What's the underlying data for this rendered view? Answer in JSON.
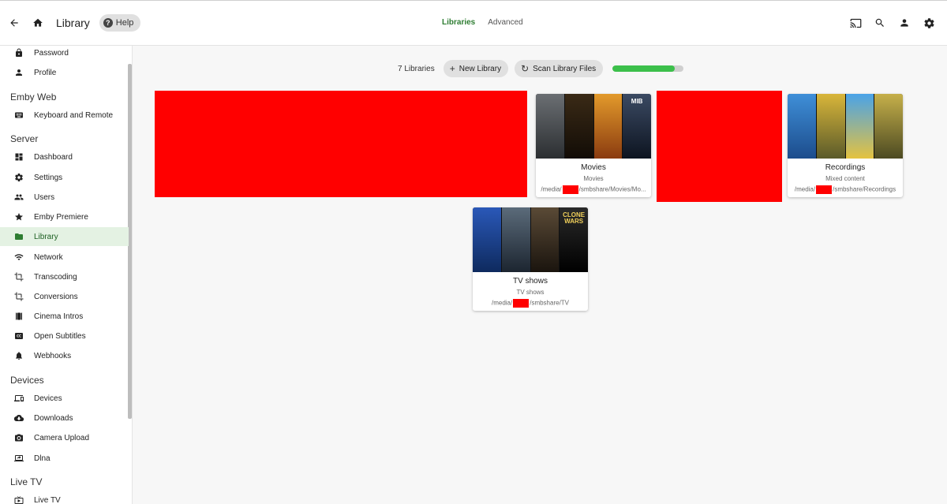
{
  "header": {
    "title": "Library",
    "help_label": "Help",
    "tabs": [
      {
        "label": "Libraries",
        "active": true
      },
      {
        "label": "Advanced",
        "active": false
      }
    ],
    "icons": [
      "back-arrow-icon",
      "home-icon",
      "cast-icon",
      "search-icon",
      "user-icon",
      "gear-icon"
    ],
    "accent_color": "#2e7d32"
  },
  "sidebar": {
    "items_top": [
      {
        "label": "Password",
        "icon": "lock-icon"
      },
      {
        "label": "Profile",
        "icon": "person-icon"
      }
    ],
    "sections": [
      {
        "title": "Emby Web",
        "items": [
          {
            "label": "Keyboard and Remote",
            "icon": "keyboard-icon"
          }
        ]
      },
      {
        "title": "Server",
        "items": [
          {
            "label": "Dashboard",
            "icon": "dashboard-icon"
          },
          {
            "label": "Settings",
            "icon": "gear-icon"
          },
          {
            "label": "Users",
            "icon": "people-icon"
          },
          {
            "label": "Emby Premiere",
            "icon": "star-icon"
          },
          {
            "label": "Library",
            "icon": "folder-icon",
            "active": true
          },
          {
            "label": "Network",
            "icon": "wifi-icon"
          },
          {
            "label": "Transcoding",
            "icon": "crop-icon"
          },
          {
            "label": "Conversions",
            "icon": "crop-icon"
          },
          {
            "label": "Cinema Intros",
            "icon": "film-icon"
          },
          {
            "label": "Open Subtitles",
            "icon": "cc-icon"
          },
          {
            "label": "Webhooks",
            "icon": "bell-icon"
          }
        ]
      },
      {
        "title": "Devices",
        "items": [
          {
            "label": "Devices",
            "icon": "devices-icon"
          },
          {
            "label": "Downloads",
            "icon": "cloud-download-icon"
          },
          {
            "label": "Camera Upload",
            "icon": "camera-icon"
          },
          {
            "label": "Dlna",
            "icon": "screen-share-icon"
          }
        ]
      },
      {
        "title": "Live TV",
        "items": [
          {
            "label": "Live TV",
            "icon": "tv-icon"
          }
        ]
      }
    ]
  },
  "toolbar": {
    "count": "7 Libraries",
    "new_library": "New Library",
    "scan_library": "Scan Library Files",
    "scan_progress_pct": 88
  },
  "libraries": [
    {
      "name": "Movies",
      "type": "Movies",
      "path_prefix": "/media/",
      "path_suffix": "/smbshare/Movies/Mo...",
      "posters": [
        "",
        "",
        "",
        "MIB"
      ]
    },
    {
      "name": "Recordings",
      "type": "Mixed content",
      "path_prefix": "/media/",
      "path_suffix": "/smbshare/Recordings",
      "posters": [
        "",
        "",
        "",
        ""
      ]
    },
    {
      "name": "TV shows",
      "type": "TV shows",
      "path_prefix": "/media/",
      "path_suffix": "/smbshare/TV",
      "posters": [
        "",
        "",
        "",
        "CLONE WARS"
      ]
    }
  ]
}
